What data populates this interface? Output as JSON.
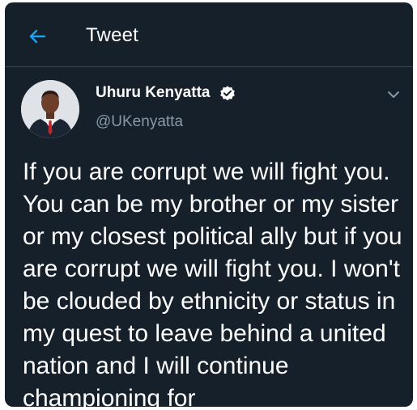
{
  "header": {
    "title": "Tweet",
    "back_icon": "arrow-left-icon"
  },
  "author": {
    "name": "Uhuru Kenyatta",
    "handle": "@UKenyatta",
    "verified_icon": "verified-badge-icon"
  },
  "menu": {
    "icon": "chevron-down-icon"
  },
  "tweet": {
    "text": "If you are corrupt we will fight you. You can be my brother or my sister or my closest political ally but if you are corrupt we will fight you. I won't be clouded by ethnicity or status in my quest to leave behind a united nation and I will continue championing for"
  },
  "colors": {
    "background": "#15202b",
    "accent": "#1da1f2",
    "muted_text": "#8899a6",
    "divider": "#38444d"
  }
}
